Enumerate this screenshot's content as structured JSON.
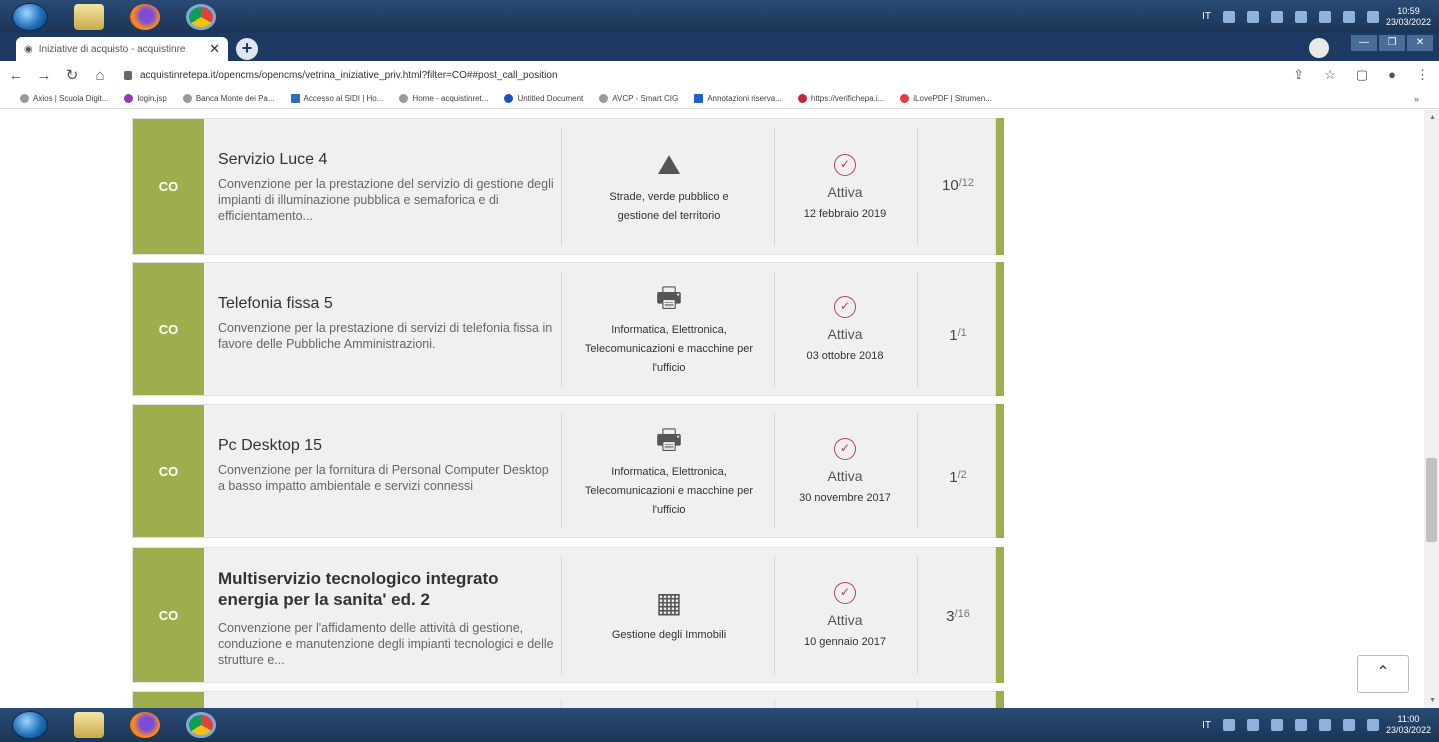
{
  "os": {
    "top_clock_time": "10:59",
    "top_clock_date": "23/03/2022",
    "bottom_clock_time": "11:00",
    "bottom_clock_date": "23/03/2022",
    "lang": "IT"
  },
  "browser": {
    "tab_title": "Iniziative di acquisto - acquistinre",
    "url": "acquistinretepa.it/opencms/opencms/vetrina_iniziative_priv.html?filter=CO##post_call_position",
    "bookmarks": [
      "Axios | Scuola Digit...",
      "login.jsp",
      "Banca Monte dei Pa...",
      "Accesso al SIDI | Ho...",
      "Home - acquistinret...",
      "Untitled Document",
      "AVCP - Smart CIG",
      "Annotazioni riserva...",
      "https://verifichepa.i...",
      "iLovePDF | Strumen..."
    ],
    "bookmarks_more": "»"
  },
  "initiatives": [
    {
      "type": "CO",
      "title": "Servizio Luce 4",
      "description": "Convenzione per la prestazione del servizio di gestione degli impianti di illuminazione pubblica e semaforica e di efficientamento...",
      "category": "Strade, verde pubblico e gestione del territorio",
      "category_icon": "road-trees-icon",
      "status": "Attiva",
      "date": "12 febbraio 2019",
      "lots_active": "10",
      "lots_total": "/12"
    },
    {
      "type": "CO",
      "title": "Telefonia fissa 5",
      "description": "Convenzione per la prestazione di servizi di telefonia fissa in favore delle Pubbliche Amministrazioni.",
      "category": "Informatica, Elettronica, Telecomunicazioni e macchine per l'ufficio",
      "category_icon": "printer-icon",
      "status": "Attiva",
      "date": "03 ottobre 2018",
      "lots_active": "1",
      "lots_total": "/1"
    },
    {
      "type": "CO",
      "title": "Pc Desktop 15",
      "description": "Convenzione per la fornitura di Personal Computer Desktop a basso impatto ambientale e servizi connessi",
      "category": "Informatica, Elettronica, Telecomunicazioni e macchine per l'ufficio",
      "category_icon": "printer-icon",
      "status": "Attiva",
      "date": "30 novembre 2017",
      "lots_active": "1",
      "lots_total": "/2"
    },
    {
      "type": "CO",
      "title": "Multiservizio tecnologico integrato energia per la sanita' ed. 2",
      "description": "Convenzione per l'affidamento delle attività di gestione, conduzione e manutenzione degli impianti tecnologici e delle strutture e...",
      "category": "Gestione degli Immobili",
      "category_icon": "building-icon",
      "status": "Attiva",
      "date": "10 gennaio 2017",
      "lots_active": "3",
      "lots_total": "/16"
    }
  ],
  "colors": {
    "accent_green": "#9fad4e",
    "status_magenta": "#b63f63",
    "card_bg": "#f0f0f0"
  }
}
